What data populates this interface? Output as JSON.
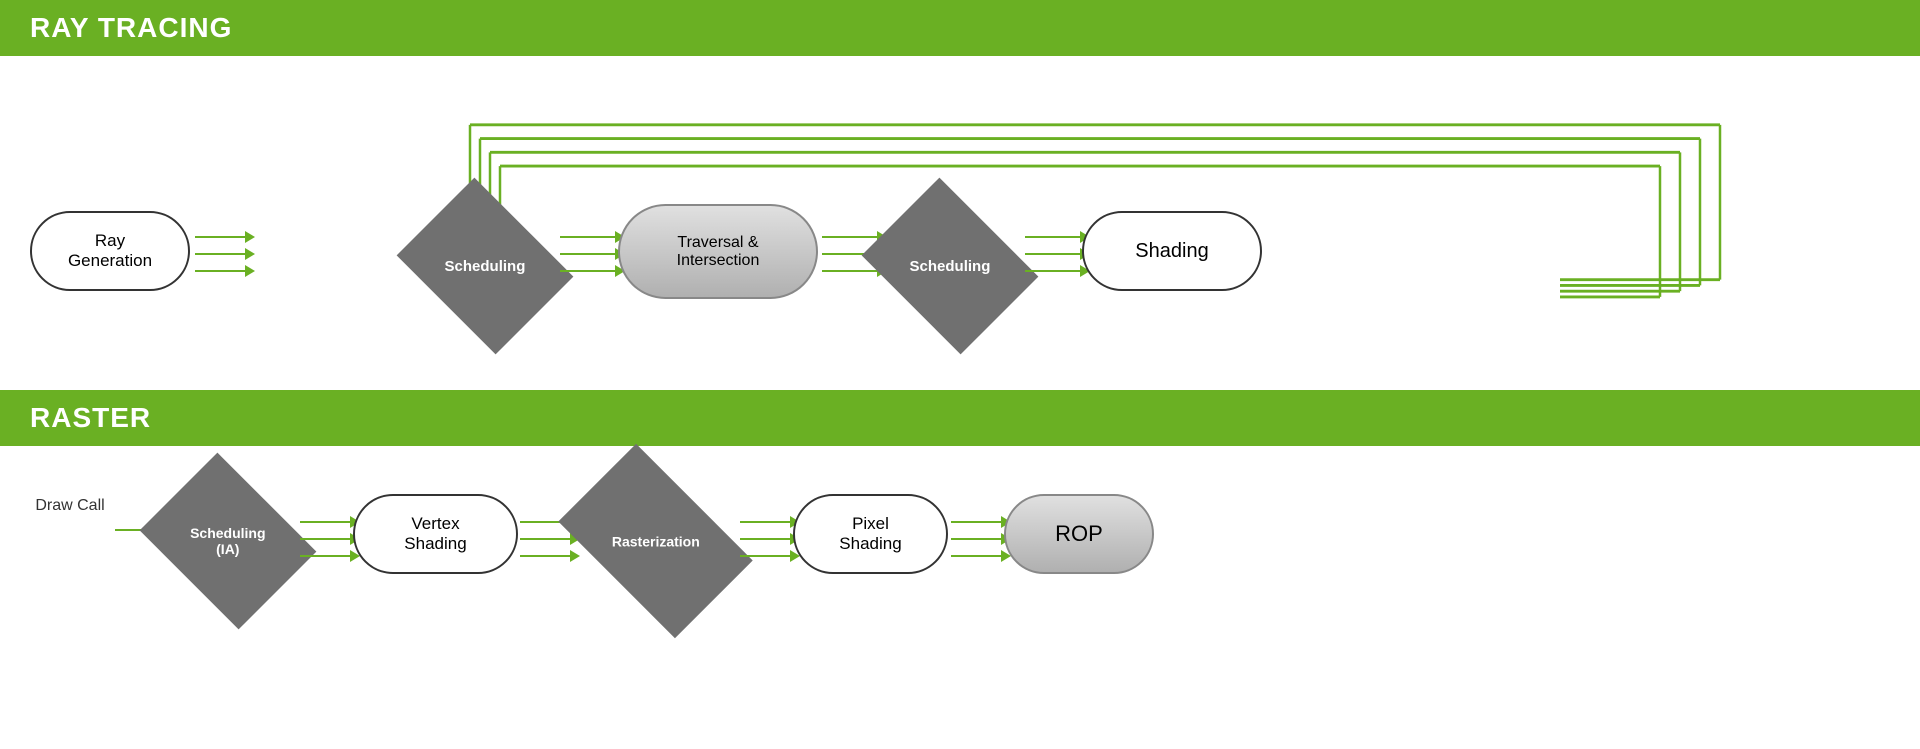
{
  "ray_tracing": {
    "header": "RAY TRACING",
    "nodes": {
      "ray_gen": "Ray\nGeneration",
      "scheduling1": "Scheduling",
      "traversal": "Traversal &\nIntersection",
      "scheduling2": "Scheduling",
      "shading": "Shading"
    }
  },
  "raster": {
    "header": "RASTER",
    "nodes": {
      "draw_call": "Draw\nCall",
      "scheduling_ia": "Scheduling\n(IA)",
      "vertex_shading": "Vertex\nShading",
      "rasterization": "Rasterization",
      "pixel_shading": "Pixel\nShading",
      "rop": "ROP"
    }
  },
  "colors": {
    "green": "#6ab023",
    "header_bg": "#6ab023",
    "diamond_bg": "#707070",
    "pill_border": "#333333"
  }
}
